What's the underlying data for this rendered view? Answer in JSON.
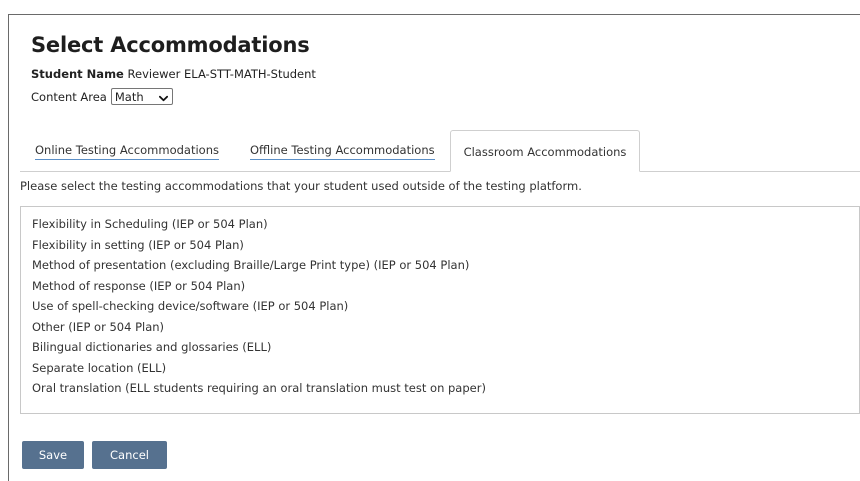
{
  "page": {
    "title": "Select Accommodations"
  },
  "student": {
    "label": "Student Name",
    "value": "Reviewer ELA-STT-MATH-Student"
  },
  "content_area": {
    "label": "Content Area",
    "selected": "Math"
  },
  "tabs": [
    {
      "label": "Online Testing Accommodations",
      "active": false
    },
    {
      "label": "Offline Testing Accommodations",
      "active": false
    },
    {
      "label": "Classroom Accommodations",
      "active": true
    }
  ],
  "instructions": "Please select the testing accommodations that your student used outside of the testing platform.",
  "accommodations": [
    "Flexibility in Scheduling (IEP or 504 Plan)",
    "Flexibility in setting (IEP or 504 Plan)",
    "Method of presentation (excluding Braille/Large Print type) (IEP or 504 Plan)",
    "Method of response (IEP or 504 Plan)",
    "Use of spell-checking device/software (IEP or 504 Plan)",
    "Other (IEP or 504 Plan)",
    "Bilingual dictionaries and glossaries (ELL)",
    "Separate location (ELL)",
    "Oral translation (ELL students requiring an oral translation must test on paper)"
  ],
  "buttons": {
    "save": "Save",
    "cancel": "Cancel"
  },
  "colors": {
    "button_bg": "#56718f",
    "tab_underline": "#5b8fc7"
  },
  "icons": {
    "select_arrow": "chevron-down-icon"
  }
}
